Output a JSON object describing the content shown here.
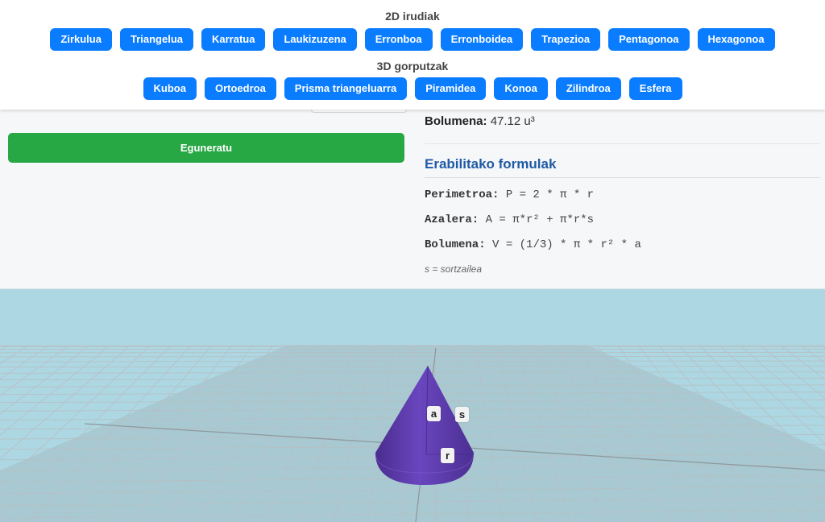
{
  "header": {
    "group_2d_title": "2D irudiak",
    "group_3d_title": "3D gorputzak",
    "buttons_2d": [
      "Zirkulua",
      "Triangelua",
      "Karratua",
      "Laukizuzena",
      "Erronboa",
      "Erronboidea",
      "Trapezioa",
      "Pentagonoa",
      "Hexagonoa"
    ],
    "buttons_3d": [
      "Kuboa",
      "Ortoedroa",
      "Prisma triangeluarra",
      "Piramidea",
      "Konoa",
      "Zilindroa",
      "Esfera"
    ]
  },
  "panel": {
    "update_label": "Eguneratu",
    "volume_label": "Bolumena:",
    "volume_value": "47.12 u³",
    "formulas_title": "Erabilitako formulak",
    "formulas": [
      {
        "label": "Perimetroa:",
        "expr": "P = 2 * π * r"
      },
      {
        "label": "Azalera:",
        "expr": "A = π*r² + π*r*s"
      },
      {
        "label": "Bolumena:",
        "expr": "V = (1/3) * π * r² * a"
      }
    ],
    "note": "s = sortzailea"
  },
  "scene": {
    "labels": {
      "height": "a",
      "slant": "s",
      "radius": "r"
    },
    "colors": {
      "background": "#add8e3",
      "cone": "#5b3aa6",
      "grid": "#b4bcc0",
      "button": "#0a7cff",
      "update": "#28a745",
      "heading": "#1f5aa6"
    }
  }
}
